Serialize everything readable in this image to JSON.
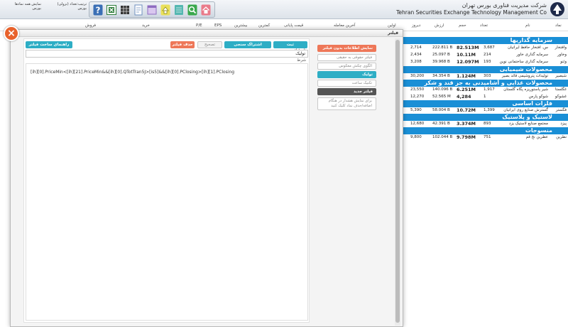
{
  "topbar": {
    "show_all_label": "نمایش همه نمادها",
    "bourse_label": "بورس",
    "order_label": "ترتیب:تعداد (نزولی)",
    "order_sub": "بورس"
  },
  "brand": {
    "name_fa": "شرکت مدیریت فناوری بورس تهران",
    "name_en": "Tehran Securities Exchange Technology Management Co"
  },
  "columns": {
    "symbol": "نماد",
    "name": "نام",
    "count": "تعداد",
    "volume": "حجم",
    "value": "ارزش",
    "yesterday": "دیروز",
    "first": "اولین",
    "last_trade": "آخرین معامله",
    "closing_price": "قیمت پایانی",
    "lowest": "کمترین",
    "highest": "بیشترین",
    "eps": "EPS",
    "pe": "P/E",
    "buy": "خرید",
    "sell": "فروش"
  },
  "market": {
    "sections": [
      {
        "title": "سرمایه گذاریها",
        "rows": [
          {
            "symbol": "وافتخار",
            "name": "س. افتخار حافظ ایرانیان",
            "count": "3,687",
            "volume": "82.513M",
            "value": "222.811 B",
            "price": "2,714"
          },
          {
            "symbol": "وخاور",
            "name": "سرمایه گذاری خاور",
            "count": "214",
            "volume": "10.11M",
            "value": "25.097 B",
            "price": "2,434"
          },
          {
            "symbol": "وثنو",
            "name": "سرمایه گذاری ساختمانی نوین",
            "count": "193",
            "volume": "12.097M",
            "value": "39.968 B",
            "price": "3,208"
          }
        ]
      },
      {
        "title": "محصولات شیمیایی",
        "rows": [
          {
            "symbol": "شبصیر",
            "name": "تولیدات پتروشیمی قائد بصیر",
            "count": "303",
            "volume": "1.124M",
            "value": "34.354 B",
            "price": "30,200"
          }
        ]
      },
      {
        "title": "محصولات غذایی و آشامیدنی به جز قند و شکر",
        "rows": [
          {
            "symbol": "غگلستا",
            "name": "شیر پاستوریزه پگاه گلستان",
            "count": "1,917",
            "volume": "6.251M",
            "value": "140.096 B",
            "price": "23,550"
          },
          {
            "symbol": "غشوکو",
            "name": "شوکو پارس",
            "count": "1",
            "volume": "4,284",
            "value": "52.565 M",
            "price": "12,270"
          }
        ]
      },
      {
        "title": "فلزات اساسی",
        "rows": [
          {
            "symbol": "فگستر",
            "name": "گسترش صنایع روی ایرانیان",
            "count": "1,399",
            "volume": "10.72M",
            "value": "58.004 B",
            "price": "5,390"
          }
        ]
      },
      {
        "title": "لاستیک و پلاستیک",
        "rows": [
          {
            "symbol": "پیزد",
            "name": "مجتمع صنایع لاستیک یزد",
            "count": "893",
            "volume": "3.374M",
            "value": "42.391 B",
            "price": "12,680"
          }
        ]
      },
      {
        "title": "منسوجات",
        "rows": [
          {
            "symbol": "نطرین",
            "name": "عطرین نخ قم",
            "count": "751",
            "volume": "9.798M",
            "value": "102.044 B",
            "price": "9,800"
          }
        ]
      }
    ]
  },
  "modal": {
    "title": "فیلتر",
    "close_label": "×",
    "buttons": {
      "save": "ثبت",
      "share": "اشتراک سنجی",
      "edit": "تصحیح",
      "delete": "حذف فیلتر",
      "build": "راهنمای ساخت فیلتر"
    },
    "name_label": "نام فیلتر",
    "name_value": "تولیک",
    "condition_label": "شرط",
    "condition_text": "[ih][0].PriceMin<[ih][21].PriceMin&&[ih][0].QTotTran5J>[is5]&&[ih][0].PClosing>[ih][1].PClosing"
  },
  "filters_nav": {
    "show_all": "نمایش اطلاعات بدون فیلتر",
    "items": [
      "فیلتر حقوقی به حقیقی",
      "الگوی چکش معکوس",
      "تولیک",
      "تکنیک ساعت"
    ],
    "new_filter": "فیلتر جدید",
    "hint": "برای نمایش هشدار در هنگام اضافه/حذف نماد کلیک کنید"
  },
  "colors": {
    "section_blue": "#1a8fd6",
    "teal": "#2eaec5",
    "orange": "#ee7758",
    "close_orange": "#e8622c"
  },
  "icons": [
    "help-icon",
    "excel-icon",
    "grid-icon",
    "document-icon",
    "calendar-icon",
    "home-up-icon",
    "notes-icon",
    "search-icon",
    "home-icon",
    "logo-icon"
  ]
}
